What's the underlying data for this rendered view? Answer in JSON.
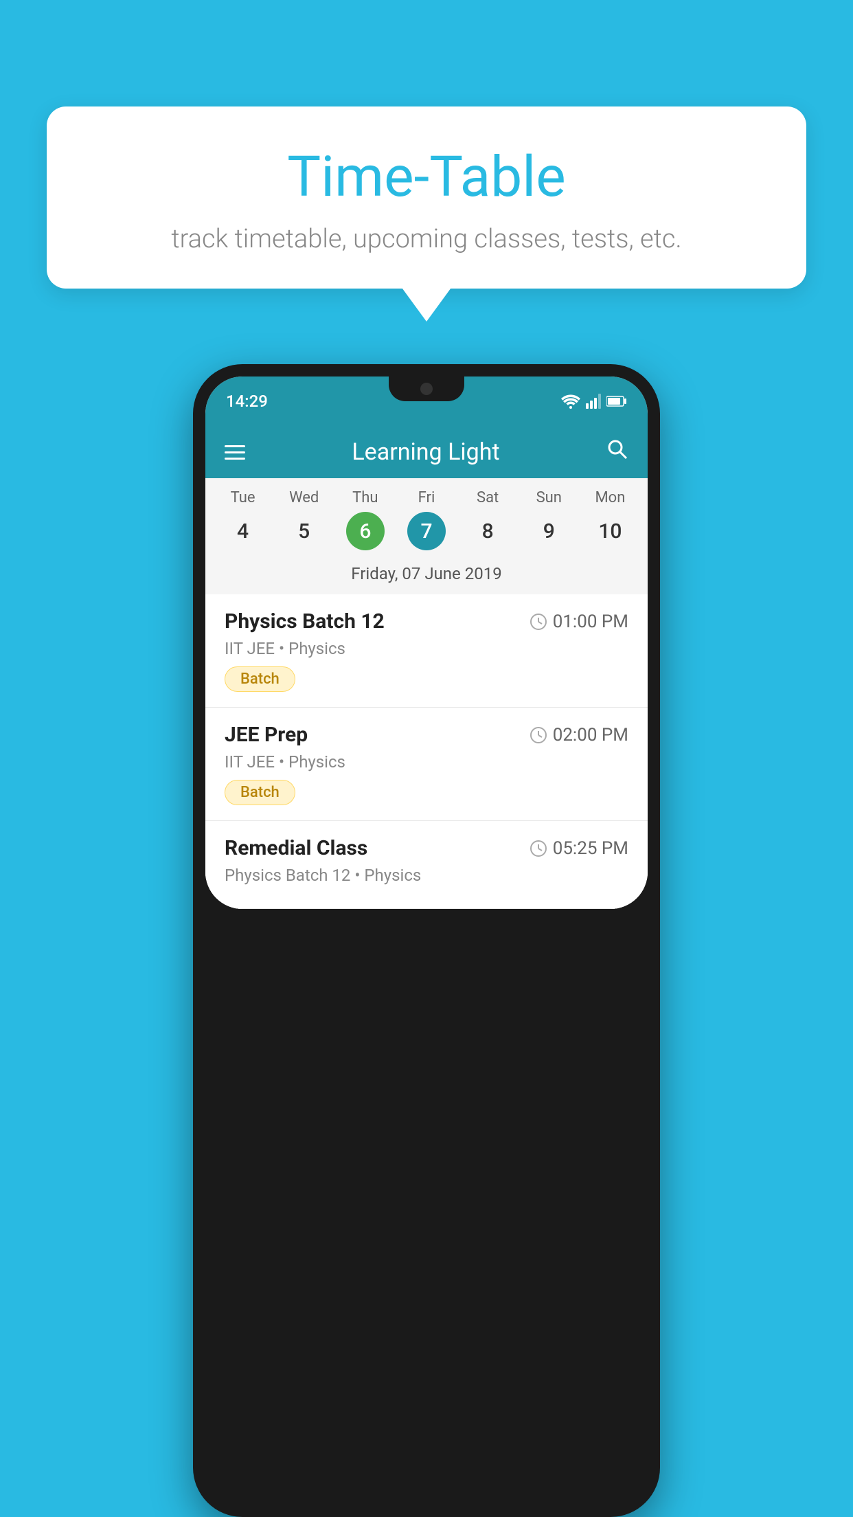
{
  "background": {
    "color": "#29BAE2"
  },
  "tooltip": {
    "title": "Time-Table",
    "subtitle": "track timetable, upcoming classes, tests, etc."
  },
  "phone": {
    "status_bar": {
      "time": "14:29"
    },
    "app_bar": {
      "title": "Learning Light",
      "menu_icon": "hamburger-icon",
      "search_icon": "search-icon"
    },
    "calendar": {
      "selected_date_label": "Friday, 07 June 2019",
      "days": [
        {
          "name": "Tue",
          "num": "4",
          "state": "normal"
        },
        {
          "name": "Wed",
          "num": "5",
          "state": "normal"
        },
        {
          "name": "Thu",
          "num": "6",
          "state": "today"
        },
        {
          "name": "Fri",
          "num": "7",
          "state": "selected"
        },
        {
          "name": "Sat",
          "num": "8",
          "state": "normal"
        },
        {
          "name": "Sun",
          "num": "9",
          "state": "normal"
        },
        {
          "name": "Mon",
          "num": "10",
          "state": "normal"
        }
      ]
    },
    "schedule_items": [
      {
        "title": "Physics Batch 12",
        "time": "01:00 PM",
        "meta": "IIT JEE • Physics",
        "tag": "Batch"
      },
      {
        "title": "JEE Prep",
        "time": "02:00 PM",
        "meta": "IIT JEE • Physics",
        "tag": "Batch"
      },
      {
        "title": "Remedial Class",
        "time": "05:25 PM",
        "meta": "Physics Batch 12 • Physics",
        "tag": ""
      }
    ]
  }
}
